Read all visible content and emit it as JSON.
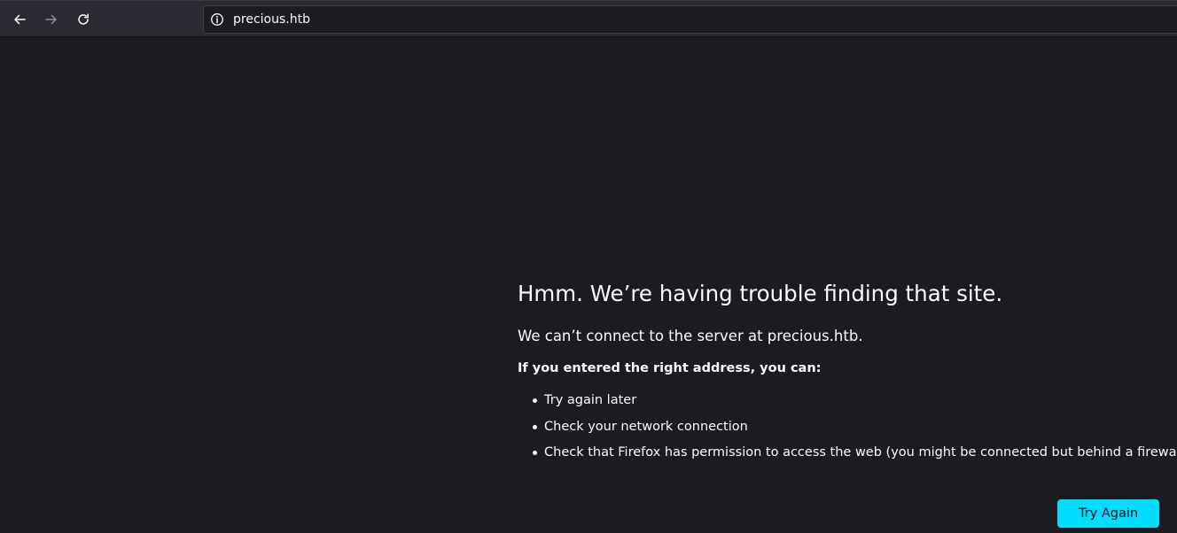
{
  "browser": {
    "url": "precious.htb",
    "icons": {
      "back": "arrow-left-icon",
      "forward": "arrow-right-icon",
      "reload": "reload-icon",
      "site_info": "info-icon"
    }
  },
  "error_page": {
    "title": "Hmm. We’re having trouble finding that site.",
    "description": "We can’t connect to the server at precious.htb.",
    "advice_heading": "If you entered the right address, you can:",
    "suggestions": [
      "Try again later",
      "Check your network connection",
      "Check that Firefox has permission to access the web (you might be connected but behind a firewall)"
    ],
    "button_label": "Try Again"
  },
  "colors": {
    "page_background": "#1c1b22",
    "toolbar_background": "#2b2a33",
    "text": "#fbfbfe",
    "button_accent": "#00ddff"
  }
}
